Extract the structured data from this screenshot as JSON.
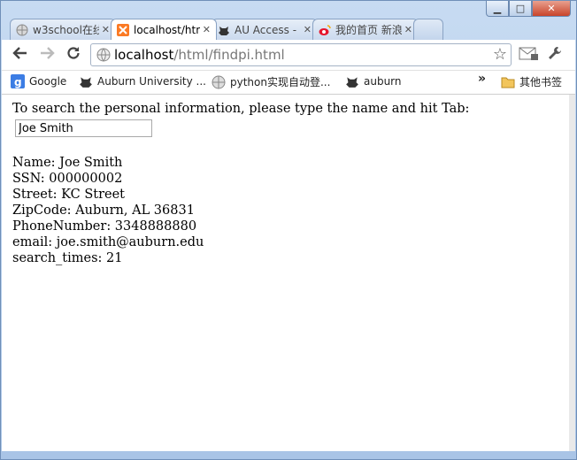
{
  "window": {
    "minimize": "▁",
    "maximize": "□",
    "close": "✕"
  },
  "tabs": [
    {
      "label": "w3school在线",
      "icon": "globe-icon",
      "close": "✕",
      "active": false
    },
    {
      "label": "localhost/html",
      "icon": "xampp-icon",
      "close": "✕",
      "active": true
    },
    {
      "label": "AU Access - ",
      "icon": "au-tiger-icon",
      "close": "✕",
      "active": false
    },
    {
      "label": "我的首页 新浪",
      "icon": "weibo-icon",
      "close": "✕",
      "active": false
    }
  ],
  "toolbar": {
    "address_host": "localhost",
    "address_path": "/html/findpi.html"
  },
  "bookmarks": {
    "items": [
      {
        "label": "Google",
        "icon": "google-icon"
      },
      {
        "label": "Auburn University ...",
        "icon": "au-tiger-icon"
      },
      {
        "label": "python实现自动登...",
        "icon": "globe-icon"
      },
      {
        "label": "auburn",
        "icon": "au-tiger-icon"
      }
    ],
    "overflow": "»",
    "other_folder": "其他书签"
  },
  "page": {
    "prompt": "To search the personal information, please type the name and hit Tab:",
    "name_value": "Joe Smith",
    "info": {
      "name": "Name: Joe Smith",
      "ssn": "SSN: 000000002",
      "street": "Street: KC Street",
      "zipcode": "ZipCode: Auburn, AL 36831",
      "phone": "PhoneNumber: 3348888880",
      "email": "email: joe.smith@auburn.edu",
      "search_times": "search_times: 21"
    }
  },
  "colors": {
    "frame": "#a9c4e6",
    "xampp": "#fb7a24",
    "google": "#3c7de4",
    "weibo": "#e6162d"
  }
}
